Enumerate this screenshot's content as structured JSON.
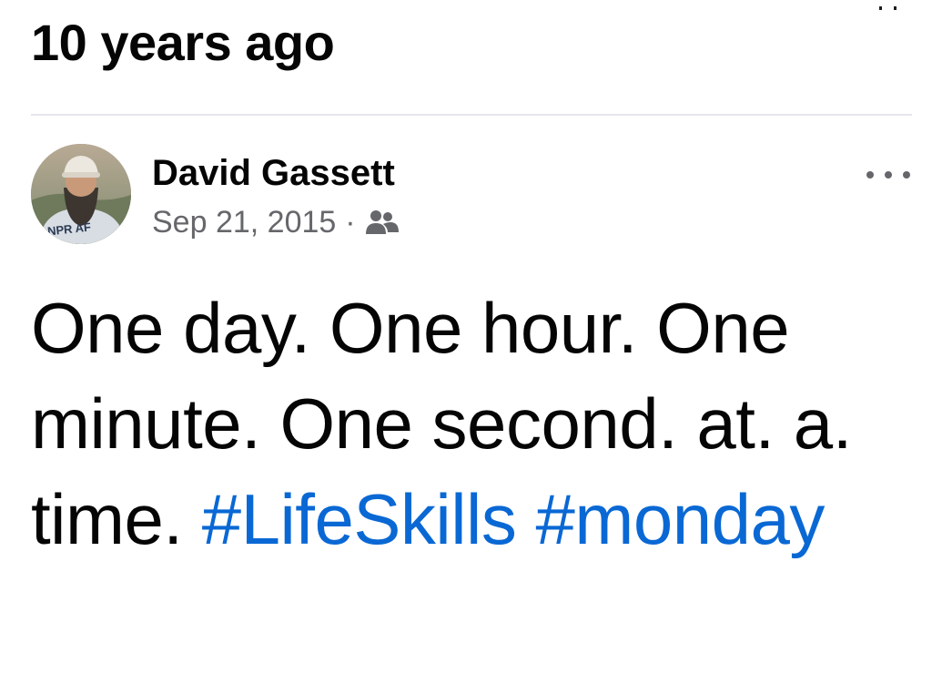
{
  "memory": {
    "title": "10 years ago"
  },
  "post": {
    "author": "David Gassett",
    "avatar_badge": "NPR AF",
    "date": "Sep 21, 2015",
    "separator": "·",
    "audience_icon": "friends-icon",
    "body_text": "One day. One hour. One minute. One second. at. a. time.",
    "hashtags": [
      "#LifeSkills",
      "#monday"
    ]
  },
  "colors": {
    "text": "#050505",
    "secondary": "#65676b",
    "link": "#0a68d4",
    "divider": "#e4e6eb"
  }
}
